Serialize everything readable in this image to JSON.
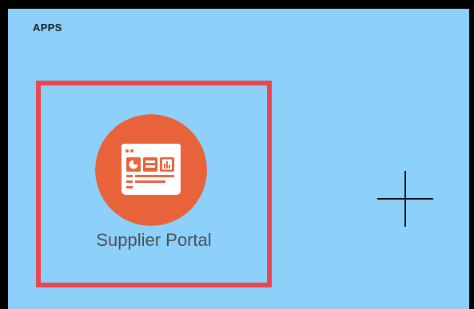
{
  "section": {
    "title": "APPS"
  },
  "tiles": [
    {
      "label": "Supplier Portal",
      "icon": "dashboard-window-icon",
      "icon_bg": "#e8623a",
      "selected": true
    }
  ],
  "add_tile": {
    "icon": "plus-icon"
  },
  "colors": {
    "background": "#8dd1fb",
    "selection_border": "#e9464d",
    "icon_circle": "#e8623a",
    "label_text": "#4a4f55"
  }
}
